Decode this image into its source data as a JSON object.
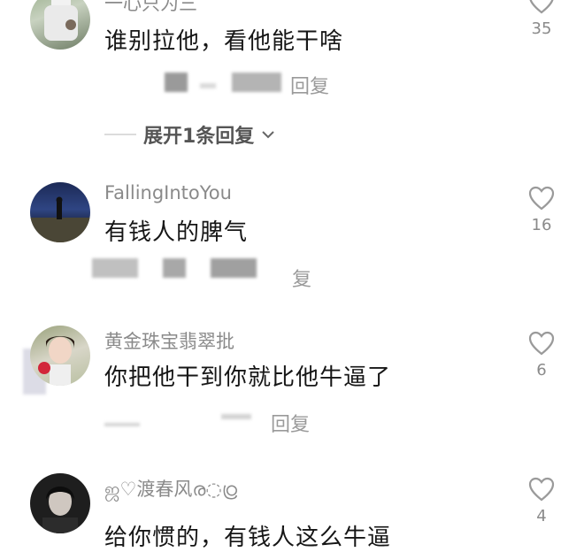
{
  "comments": [
    {
      "username": "一心只为三",
      "text": "谁别拉他，看他能干啥",
      "likes": "35",
      "reply": "回复",
      "expand": "展开1条回复"
    },
    {
      "username": "FallingIntoYou",
      "text": "有钱人的脾气",
      "likes": "16",
      "reply": "复"
    },
    {
      "username": "黄金珠宝翡翠批",
      "text": "你把他干到你就比他牛逼了",
      "likes": "6",
      "reply": "回复"
    },
    {
      "username": "ஜ♡渡春风ര◌ഠ്ര",
      "text": "给你惯的，有钱人这么牛逼",
      "likes": "4"
    }
  ],
  "icons": {
    "like": "heart-outline-icon",
    "expand": "chevron-down-icon"
  },
  "colors": {
    "text": "#161616",
    "meta": "#8a8a8a",
    "icon": "#9a9a9a"
  }
}
